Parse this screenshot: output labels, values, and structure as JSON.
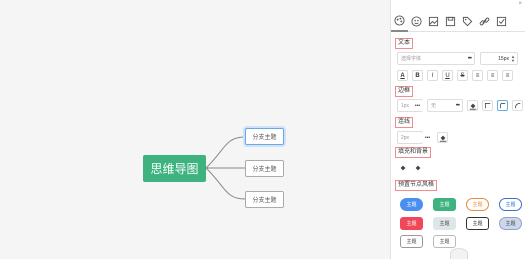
{
  "canvas": {
    "root_label": "思维导图",
    "children": [
      "分支主题",
      "分支主题",
      "分支主题"
    ]
  },
  "panel": {
    "close_label": "×",
    "tabs": [
      "palette-icon",
      "emoji-icon",
      "image-icon",
      "save-icon",
      "tag-icon",
      "link-icon",
      "check-icon"
    ],
    "text_section": {
      "title": "文本",
      "font_placeholder": "选择字体",
      "font_size": "15px",
      "format_buttons": [
        "A",
        "B",
        "I",
        "U",
        "S",
        "≡",
        "≡",
        "≡"
      ]
    },
    "border_section": {
      "title": "边框",
      "width_value": "1px",
      "style_value": "无"
    },
    "line_section": {
      "title": "连线",
      "width_value": "2px"
    },
    "fill_section": {
      "title": "填充和背景"
    },
    "preset_section": {
      "title": "预置节点风格",
      "styles": [
        "主题",
        "主题",
        "主题",
        "主题",
        "主题",
        "主题",
        "主题",
        "主题",
        "主题",
        "主题"
      ]
    }
  },
  "colors": {
    "root_fill": "#3eb37f",
    "selected_border": "#6aa9e8",
    "section_title_border": "#f28b8b"
  }
}
